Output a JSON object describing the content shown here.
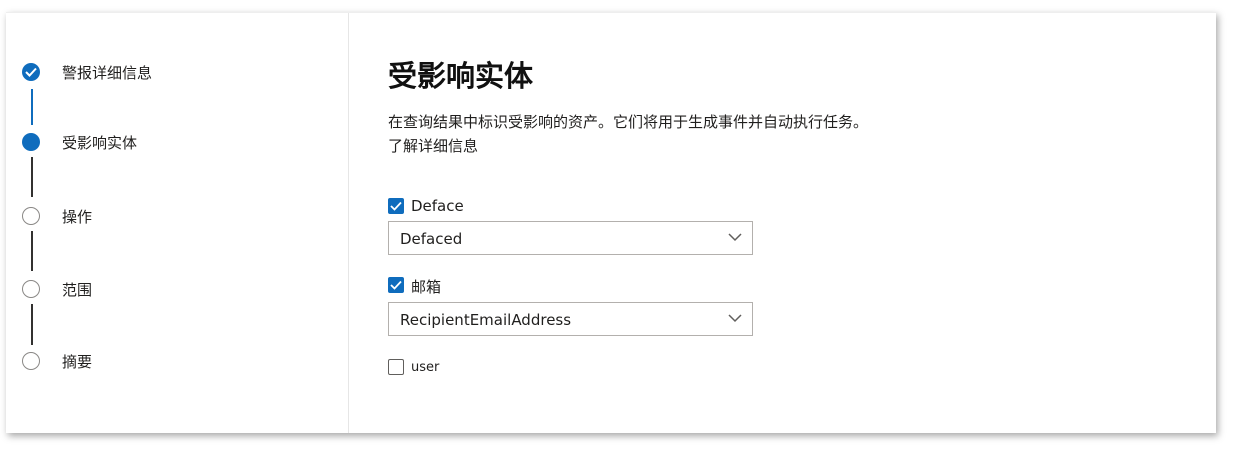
{
  "wizard": {
    "steps": [
      {
        "label": "警报详细信息",
        "state": "completed"
      },
      {
        "label": "受影响实体",
        "state": "current"
      },
      {
        "label": "操作",
        "state": "pending"
      },
      {
        "label": "范围",
        "state": "pending"
      },
      {
        "label": "摘要",
        "state": "pending"
      }
    ]
  },
  "main": {
    "title": "受影响实体",
    "description": "在查询结果中标识受影响的资产。它们将用于生成事件并自动执行任务。",
    "learn_more": "了解详细信息"
  },
  "entities": [
    {
      "label": "Deface",
      "checked": true,
      "dropdown_value": "Defaced"
    },
    {
      "label": "邮箱",
      "checked": true,
      "dropdown_value": "RecipientEmailAddress"
    },
    {
      "label": "user",
      "checked": false
    }
  ],
  "colors": {
    "accent": "#0f6cbd",
    "connector_pending": "#323130",
    "text": "#201f1e"
  },
  "icons": {
    "completed_step": "checkmark-circle-icon",
    "dropdown": "chevron-down-icon",
    "checkbox_checked": "checkmark-icon"
  }
}
